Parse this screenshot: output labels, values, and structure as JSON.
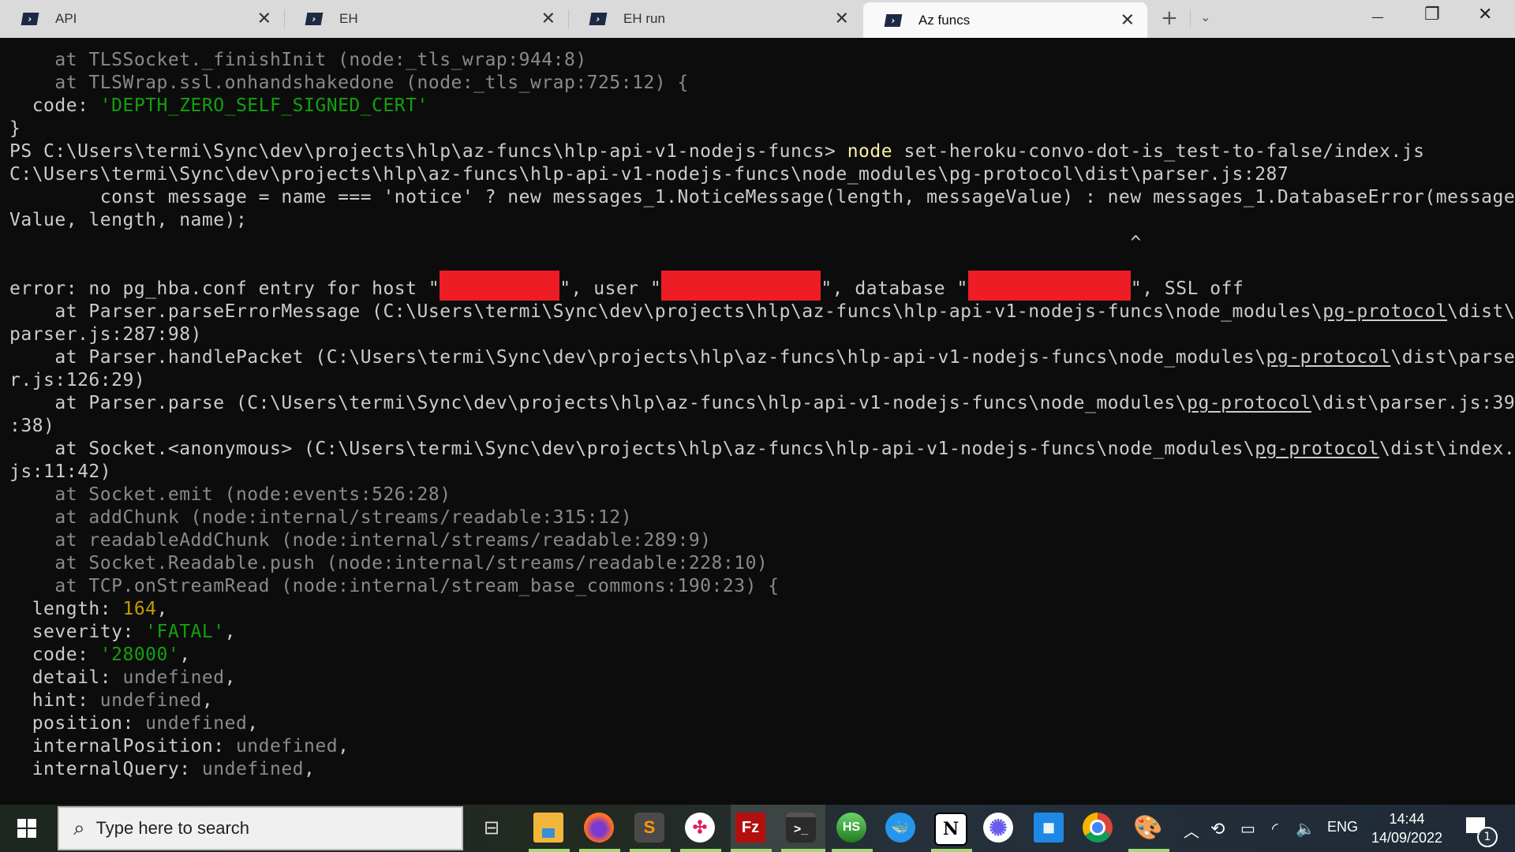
{
  "window": {
    "tabs": [
      {
        "label": "API",
        "icon": "powershell-icon",
        "active": false
      },
      {
        "label": "EH",
        "icon": "powershell-icon",
        "active": false
      },
      {
        "label": "EH run",
        "icon": "powershell-icon",
        "active": false
      },
      {
        "label": "Az funcs",
        "icon": "powershell-icon",
        "active": true
      }
    ],
    "close_glyph": "✕",
    "new_tab_glyph": "+",
    "dropdown_glyph": "⌄",
    "minimize_glyph": "—",
    "maximize_glyph": "❐",
    "window_close_glyph": "✕"
  },
  "terminal": {
    "lines": {
      "l1": "    at TLSSocket._finishInit (node:_tls_wrap:944:8)",
      "l2": "    at TLSWrap.ssl.onhandshakedone (node:_tls_wrap:725:12) {",
      "l3_key": "  code: ",
      "l3_val": "'DEPTH_ZERO_SELF_SIGNED_CERT'",
      "l4": "}",
      "l5_prompt": "PS C:\\Users\\termi\\Sync\\dev\\projects\\hlp\\az-funcs\\hlp-api-v1-nodejs-funcs> ",
      "l5_cmd": "node",
      "l5_args": " set-heroku-convo-dot-is_test-to-false/index.js",
      "l6": "C:\\Users\\termi\\Sync\\dev\\projects\\hlp\\az-funcs\\hlp-api-v1-nodejs-funcs\\node_modules\\pg-protocol\\dist\\parser.js:287",
      "l7": "        const message = name === 'notice' ? new messages_1.NoticeMessage(length, messageValue) : new messages_1.DatabaseError(message",
      "l8": "Value, length, name);",
      "l9": "                                                                                                   ^",
      "l11_a": "error: no pg_hba.conf entry for host \"",
      "l11_b": "\", user \"",
      "l11_c": "\", database \"",
      "l11_d": "\", SSL off",
      "l12_a": "    at Parser.parseErrorMessage (C:\\Users\\termi\\Sync\\dev\\projects\\hlp\\az-funcs\\hlp-api-v1-nodejs-funcs\\node_modules\\",
      "l12_link": "pg-protocol",
      "l12_b": "\\dist\\",
      "l13": "parser.js:287:98)",
      "l14_a": "    at Parser.handlePacket (C:\\Users\\termi\\Sync\\dev\\projects\\hlp\\az-funcs\\hlp-api-v1-nodejs-funcs\\node_modules\\",
      "l14_link": "pg-protocol",
      "l14_b": "\\dist\\parse",
      "l15": "r.js:126:29)",
      "l16_a": "    at Parser.parse (C:\\Users\\termi\\Sync\\dev\\projects\\hlp\\az-funcs\\hlp-api-v1-nodejs-funcs\\node_modules\\",
      "l16_link": "pg-protocol",
      "l16_b": "\\dist\\parser.js:39",
      "l17": ":38)",
      "l18_a": "    at Socket.<anonymous> (C:\\Users\\termi\\Sync\\dev\\projects\\hlp\\az-funcs\\hlp-api-v1-nodejs-funcs\\node_modules\\",
      "l18_link": "pg-protocol",
      "l18_b": "\\dist\\index.",
      "l19": "js:11:42)",
      "l20": "    at Socket.emit (node:events:526:28)",
      "l21": "    at addChunk (node:internal/streams/readable:315:12)",
      "l22": "    at readableAddChunk (node:internal/streams/readable:289:9)",
      "l23": "    at Socket.Readable.push (node:internal/streams/readable:228:10)",
      "l24": "    at TCP.onStreamRead (node:internal/stream_base_commons:190:23) {",
      "l25_key": "  length: ",
      "l25_val": "164",
      "l25_end": ",",
      "l26_key": "  severity: ",
      "l26_val": "'FATAL'",
      "l26_end": ",",
      "l27_key": "  code: ",
      "l27_val": "'28000'",
      "l27_end": ",",
      "l28_key": "  detail: ",
      "l28_val": "undefined",
      "l28_end": ",",
      "l29_key": "  hint: ",
      "l29_val": "undefined",
      "l29_end": ",",
      "l30_key": "  position: ",
      "l30_val": "undefined",
      "l30_end": ",",
      "l31_key": "  internalPosition: ",
      "l31_val": "undefined",
      "l31_end": ",",
      "l32_key": "  internalQuery: ",
      "l32_val": "undefined",
      "l32_end": ","
    },
    "colors": {
      "string": "#13a10e",
      "number": "#c19c00",
      "command": "#f9f1a5",
      "redaction": "#ee1c25"
    }
  },
  "taskbar": {
    "search_placeholder": "Type here to search",
    "apps": [
      {
        "name": "task-view",
        "label": ""
      },
      {
        "name": "file-explorer",
        "label": ""
      },
      {
        "name": "firefox",
        "label": ""
      },
      {
        "name": "sublime-text",
        "label": "S"
      },
      {
        "name": "slack",
        "label": ""
      },
      {
        "name": "filezilla",
        "label": "Fz"
      },
      {
        "name": "windows-terminal",
        "label": ">_"
      },
      {
        "name": "heidisql",
        "label": "HS"
      },
      {
        "name": "docker",
        "label": ""
      },
      {
        "name": "notion",
        "label": "N"
      },
      {
        "name": "app-asterisk",
        "label": ""
      },
      {
        "name": "calendar",
        "label": ""
      },
      {
        "name": "chrome",
        "label": ""
      },
      {
        "name": "paint",
        "label": ""
      }
    ],
    "tray": {
      "language": "ENG",
      "time": "14:44",
      "date": "14/09/2022",
      "notification_count": "1"
    }
  }
}
